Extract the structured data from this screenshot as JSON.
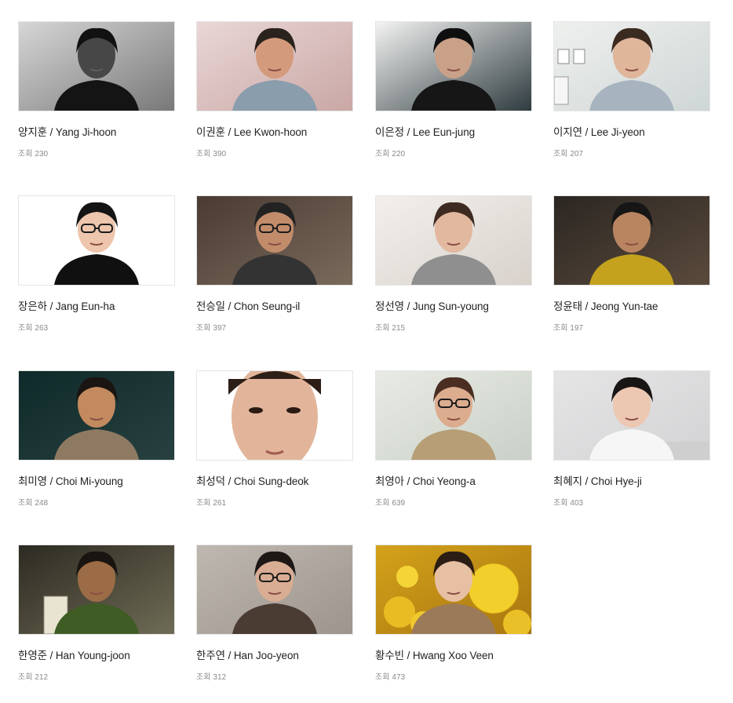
{
  "views_label": "조회",
  "artists": [
    {
      "name": "양지훈 / Yang Ji-hoon",
      "views": "230",
      "photo": "portrait-man-monochrome"
    },
    {
      "name": "이권훈 / Lee Kwon-hoon",
      "views": "390",
      "photo": "portrait-man-scarf"
    },
    {
      "name": "이은정 / Lee Eun-jung",
      "views": "220",
      "photo": "portrait-woman-black"
    },
    {
      "name": "이지연 / Lee Ji-yeon",
      "views": "207",
      "photo": "portrait-woman-office"
    },
    {
      "name": "장은하 / Jang Eun-ha",
      "views": "263",
      "photo": "portrait-woman-glasses"
    },
    {
      "name": "전승일 / Chon Seung-il",
      "views": "397",
      "photo": "portrait-man-glasses-vest"
    },
    {
      "name": "정선영 / Jung Sun-young",
      "views": "215",
      "photo": "portrait-woman-grey-jacket"
    },
    {
      "name": "정윤태 / Jeong Yun-tae",
      "views": "197",
      "photo": "portrait-man-yellow-jacket"
    },
    {
      "name": "최미영 / Choi Mi-young",
      "views": "248",
      "photo": "portrait-woman-dark-scarf"
    },
    {
      "name": "최성덕 / Choi Sung-deok",
      "views": "261",
      "photo": "portrait-young-man-closeup"
    },
    {
      "name": "최영아 / Choi Yeong-a",
      "views": "639",
      "photo": "portrait-woman-glasses-sweater"
    },
    {
      "name": "최혜지 / Choi Hye-ji",
      "views": "403",
      "photo": "portrait-woman-white-top"
    },
    {
      "name": "한영준 / Han Young-joon",
      "views": "212",
      "photo": "portrait-man-green-painting"
    },
    {
      "name": "한주연 / Han Joo-yeon",
      "views": "312",
      "photo": "portrait-woman-round-glasses"
    },
    {
      "name": "황수빈 / Hwang Xoo Veen",
      "views": "473",
      "photo": "portrait-woman-yellow-balloons"
    }
  ]
}
